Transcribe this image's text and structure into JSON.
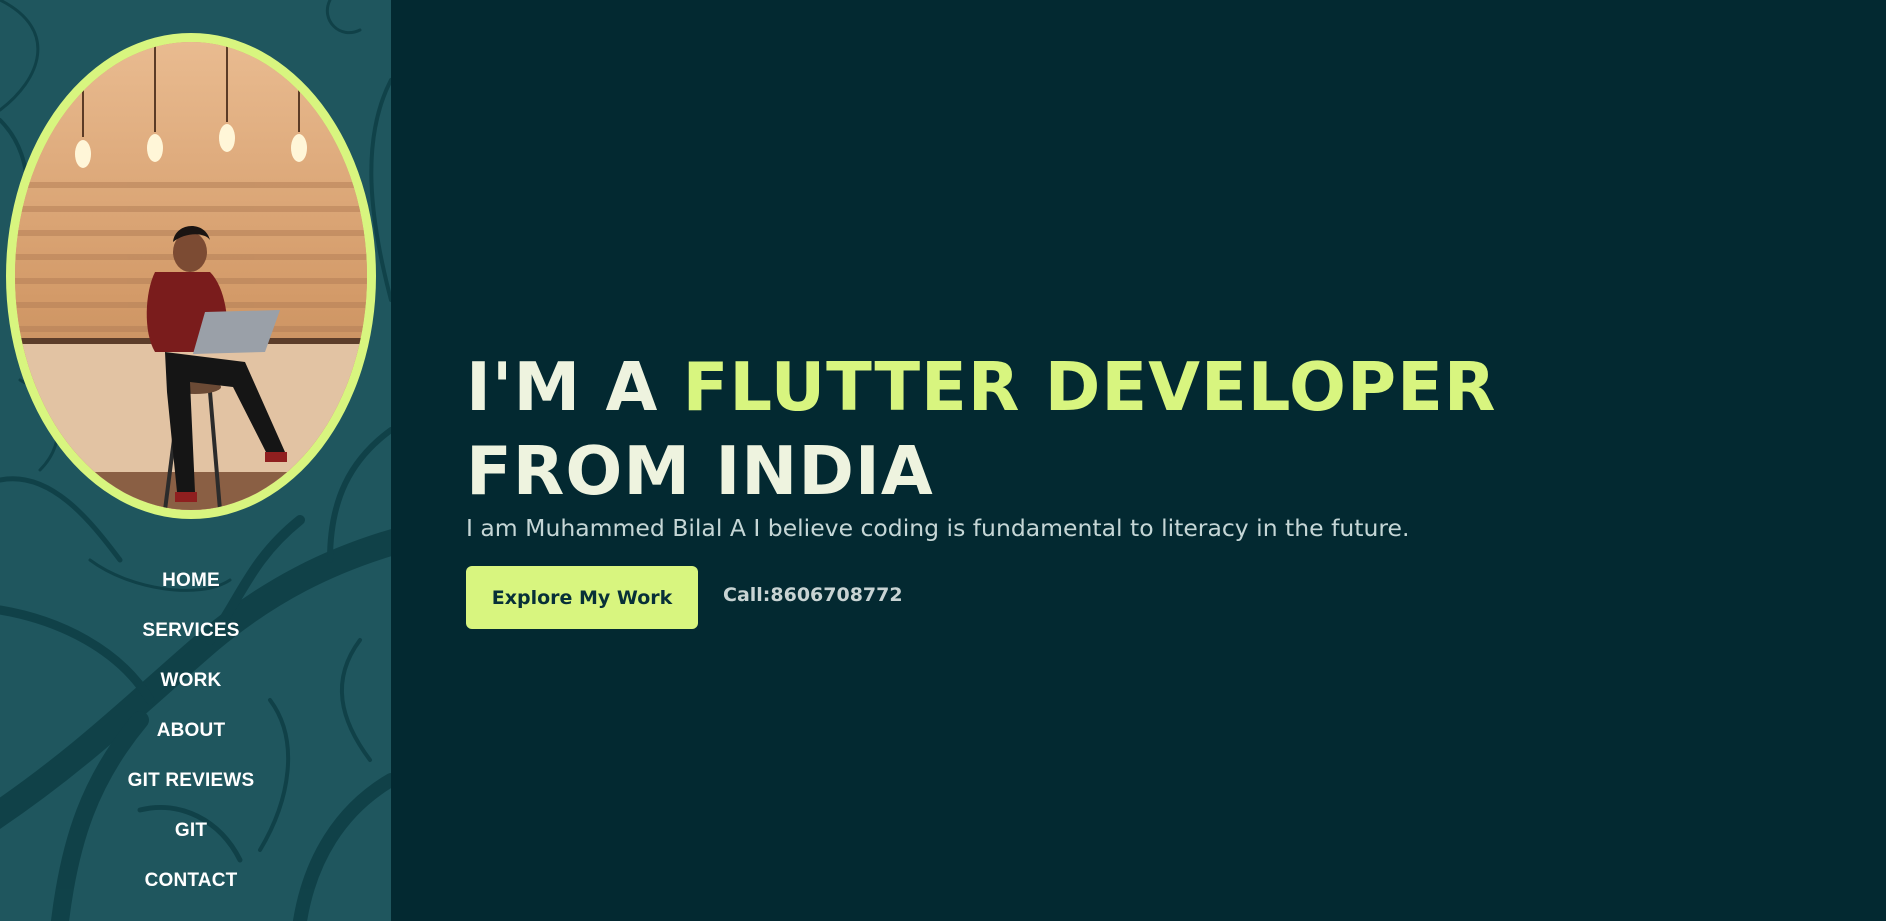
{
  "colors": {
    "background": "#032931",
    "sidebar": "#1f565e",
    "accent": "#d8f57f",
    "headline": "#eef3df"
  },
  "sidebar": {
    "portrait_icon": "profile-photo",
    "nav": [
      {
        "label": "HOME"
      },
      {
        "label": "SERVICES"
      },
      {
        "label": "WORK"
      },
      {
        "label": "ABOUT"
      },
      {
        "label": "GIT REVIEWS"
      },
      {
        "label": "GIT"
      },
      {
        "label": "CONTACT"
      }
    ]
  },
  "hero": {
    "headline_prefix": "I'M A ",
    "headline_accent": "FLUTTER DEVELOPER",
    "headline_line2": "FROM INDIA",
    "subtitle": "I am Muhammed Bilal A I believe coding is fundamental to literacy in the future.",
    "cta_label": "Explore My Work",
    "call_text": "Call:8606708772"
  }
}
